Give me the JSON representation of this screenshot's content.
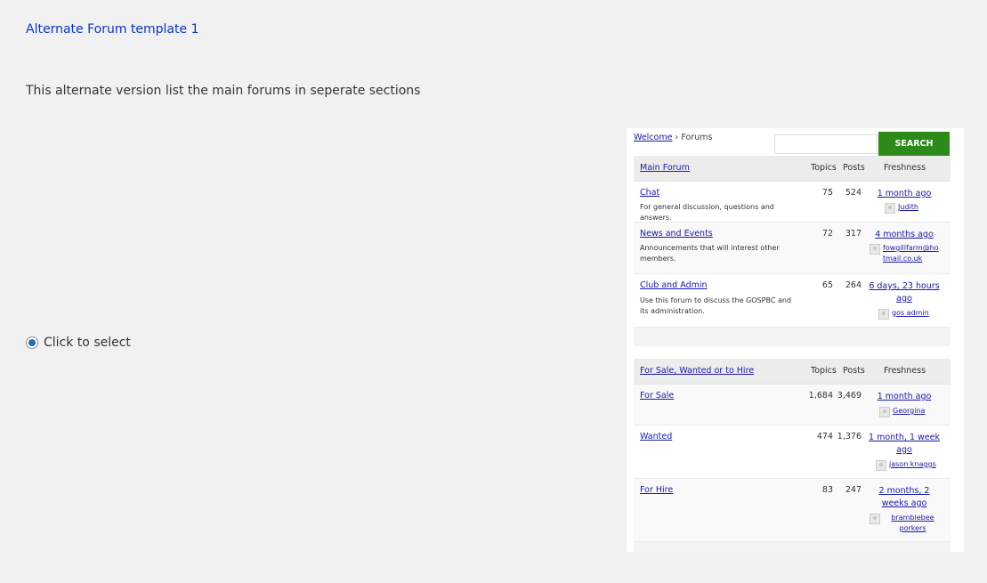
{
  "title": "Alternate Forum template 1",
  "description": "This alternate version list the main forums in seperate sections",
  "select_label": "Click to select",
  "preview": {
    "breadcrumb": {
      "home": "Welcome",
      "separator": "›",
      "current": "Forums"
    },
    "search": {
      "placeholder": "",
      "button": "SEARCH"
    },
    "columns": {
      "topics": "Topics",
      "posts": "Posts",
      "freshness": "Freshness"
    },
    "sections": [
      {
        "title": "Main Forum",
        "forums": [
          {
            "title": "Chat",
            "desc": "For general discussion, questions and answers.",
            "topics": "75",
            "posts": "524",
            "fresh": "1 month ago",
            "user": "Judith"
          },
          {
            "title": "News and Events",
            "desc": "Announcements that will interest other members.",
            "topics": "72",
            "posts": "317",
            "fresh": "4 months ago",
            "user": "fowgillfarm@hotmail.co.uk"
          },
          {
            "title": "Club and Admin",
            "desc": "Use this forum to discuss the GOSPBC and its administration.",
            "topics": "65",
            "posts": "264",
            "fresh": "6 days, 23 hours ago",
            "user": "gos admin"
          }
        ]
      },
      {
        "title": "For Sale, Wanted or to Hire",
        "forums": [
          {
            "title": "For Sale",
            "desc": "",
            "topics": "1,684",
            "posts": "3,469",
            "fresh": "1 month ago",
            "user": "Georgina"
          },
          {
            "title": "Wanted",
            "desc": "",
            "topics": "474",
            "posts": "1,376",
            "fresh": "1 month, 1 week ago",
            "user": "jason knaggs"
          },
          {
            "title": "For Hire",
            "desc": "",
            "topics": "83",
            "posts": "247",
            "fresh": "2 months, 2 weeks ago",
            "user": "bramblebee porkers"
          }
        ]
      }
    ]
  },
  "colors": {
    "title": "#0a36c8",
    "search_button": "#2d8a1a",
    "link": "#1a1aa6",
    "radio_selected": "#2271b1"
  }
}
